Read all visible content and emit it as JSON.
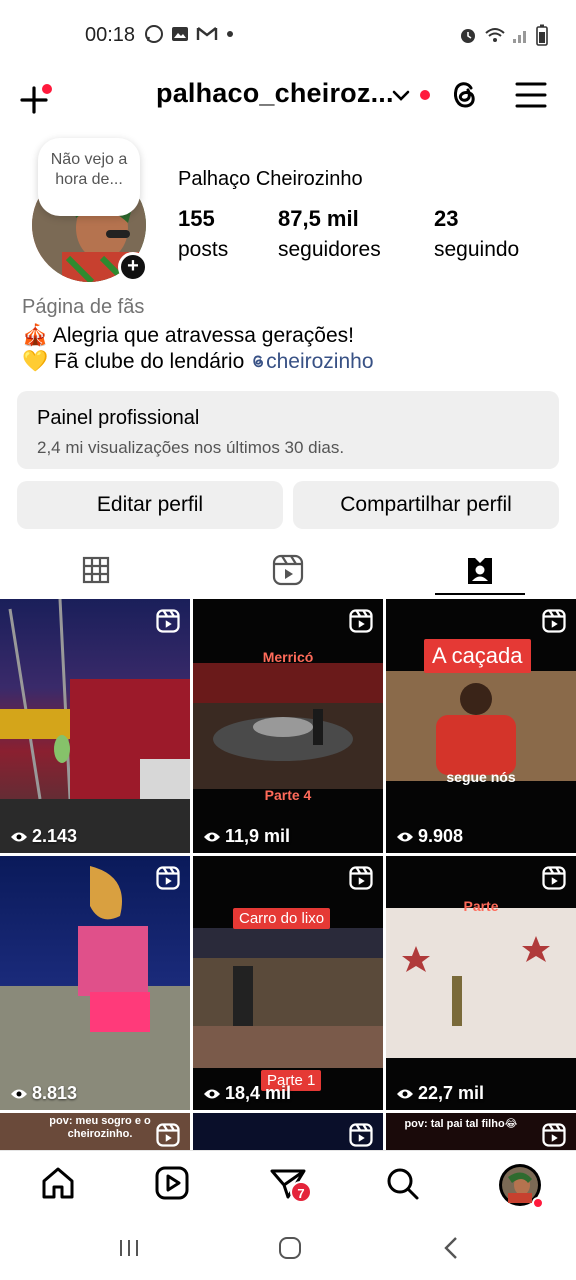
{
  "status": {
    "time": "00:18",
    "left_icons": [
      "whatsapp-icon",
      "gallery-icon",
      "gmail-icon",
      "dot-icon"
    ],
    "right_icons": [
      "alarm-icon",
      "wifi-icon",
      "signal-icon",
      "battery-icon"
    ]
  },
  "header": {
    "username": "palhaco_cheiroz...",
    "icons": [
      "plus-icon",
      "chevron-down-icon",
      "threads-icon",
      "menu-icon"
    ]
  },
  "profile": {
    "note": "Não vejo a hora de...",
    "display_name": "Palhaço Cheirozinho",
    "stats": [
      {
        "num": "155",
        "label": "posts"
      },
      {
        "num": "87,5 mil",
        "label": "seguidores"
      },
      {
        "num": "23",
        "label": "seguindo"
      }
    ],
    "category": "Página de fãs",
    "bio_line1": "🎪 Alegria que atravessa gerações!",
    "bio_line2_prefix": "💛 Fã clube do lendário ",
    "bio_mention": "cheirozinho"
  },
  "pro_panel": {
    "title": "Painel profissional",
    "subtitle": "2,4 mi visualizações nos últimos 30 dias."
  },
  "buttons": {
    "edit": "Editar perfil",
    "share": "Compartilhar perfil"
  },
  "tabs": [
    "grid-icon",
    "reels-icon",
    "tagged-icon"
  ],
  "posts": [
    {
      "views": "2.143",
      "caption_top": "",
      "caption_bottom": ""
    },
    {
      "views": "11,9 mil",
      "caption_top": "Merricó",
      "caption_bottom": "Parte 4"
    },
    {
      "views": "9.908",
      "caption_top": "A caçada",
      "caption_bottom": "segue nós"
    },
    {
      "views": "8.813",
      "caption_top": "",
      "caption_bottom": ""
    },
    {
      "views": "18,4 mil",
      "caption_top": "Carro do lixo",
      "caption_bottom": "Parte 1"
    },
    {
      "views": "22,7 mil",
      "caption_top": "Parte",
      "caption_bottom": ""
    },
    {
      "views": "",
      "caption_top": "pov: meu sogro e o cheirozinho.",
      "caption_bottom": ""
    },
    {
      "views": "",
      "caption_top": "",
      "caption_bottom": ""
    },
    {
      "views": "",
      "caption_top": "pov: tal pai tal filho😂",
      "caption_bottom": ""
    }
  ],
  "bottom_nav": {
    "items": [
      "home-icon",
      "reels-icon",
      "messages-icon",
      "search-icon",
      "profile-avatar"
    ],
    "messages_badge": "7"
  },
  "colors": {
    "accent_red": "#ff1a3c",
    "mention_blue": "#385185",
    "panel_gray": "#efefef"
  }
}
